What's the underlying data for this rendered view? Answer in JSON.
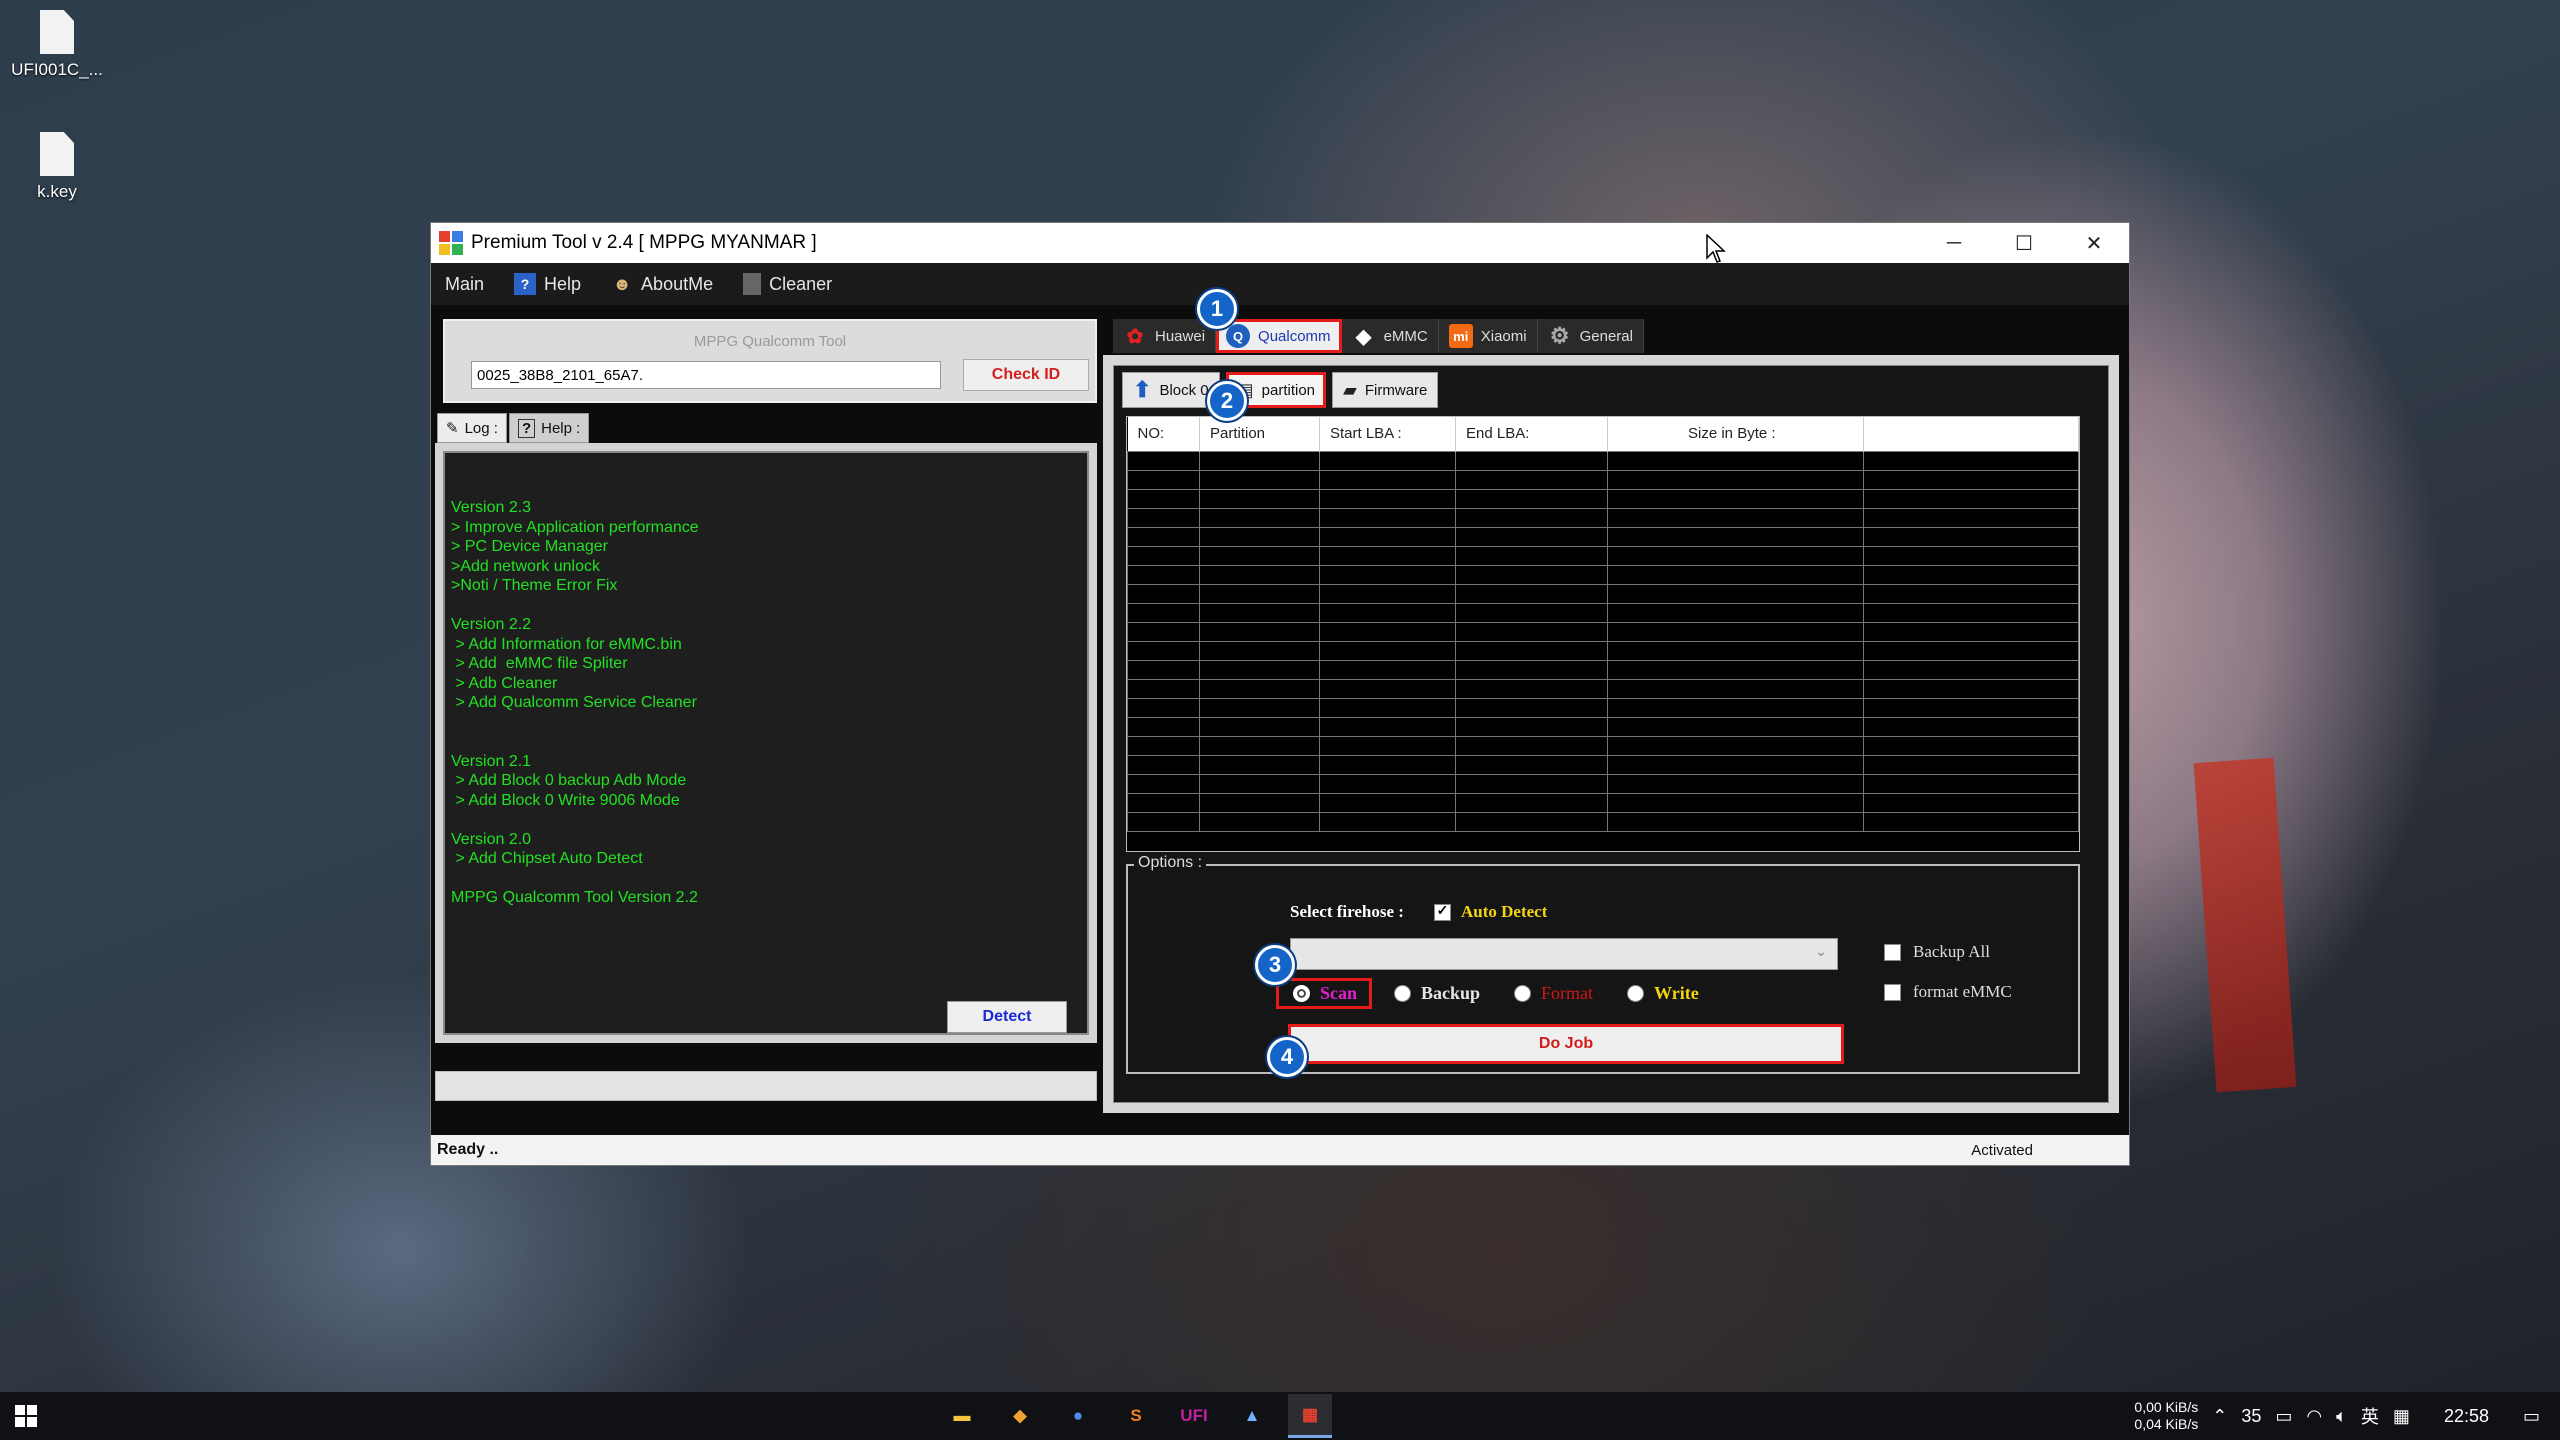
{
  "desktop": {
    "icons": [
      {
        "label": "UFI001C_...",
        "icon": "file-icon"
      },
      {
        "label": "k.key",
        "icon": "file-icon"
      }
    ]
  },
  "window": {
    "title": "Premium Tool v 2.4  [ MPPG MYANMAR ]",
    "controls": {
      "minimize": "─",
      "maximize": "☐",
      "close": "✕"
    }
  },
  "menu": [
    {
      "label": "Main",
      "icon": ""
    },
    {
      "label": "Help",
      "icon": "help-icon"
    },
    {
      "label": "AboutMe",
      "icon": "user-icon"
    },
    {
      "label": "Cleaner",
      "icon": "trash-icon"
    }
  ],
  "left": {
    "tool_label": "MPPG Qualcomm Tool",
    "device_id": "0025_38B8_2101_65A7.",
    "check_id_label": "Check ID",
    "tabs": [
      {
        "label": "Log :"
      },
      {
        "label": "Help :"
      }
    ],
    "log_lines": [
      "Version 2.3",
      "> Improve Application performance",
      "> PC Device Manager",
      ">Add network unlock",
      ">Noti / Theme Error Fix",
      "",
      "Version 2.2",
      " > Add Information for eMMC.bin",
      " > Add  eMMC file Spliter",
      " > Adb Cleaner",
      " > Add Qualcomm Service Cleaner",
      "",
      "",
      "Version 2.1",
      " > Add Block 0 backup Adb Mode",
      " > Add Block 0 Write 9006 Mode",
      "",
      "Version 2.0",
      " > Add Chipset Auto Detect",
      "",
      "MPPG Qualcomm Tool Version 2.2"
    ],
    "detect_label": "Detect"
  },
  "right": {
    "main_tabs": [
      {
        "label": "Huawei",
        "icon": "huawei-icon",
        "active": false
      },
      {
        "label": "Qualcomm",
        "icon": "qualcomm-icon",
        "active": true
      },
      {
        "label": "eMMC",
        "icon": "chip-icon",
        "active": false
      },
      {
        "label": "Xiaomi",
        "icon": "xiaomi-icon",
        "active": false
      },
      {
        "label": "General",
        "icon": "gear-icon",
        "active": false
      }
    ],
    "sub_tabs": [
      {
        "label": "Block 0",
        "icon": "upload-icon",
        "active": false
      },
      {
        "label": "partition",
        "icon": "partition-icon",
        "active": true
      },
      {
        "label": "Firmware",
        "icon": "firmware-icon",
        "active": false
      }
    ],
    "table_headers": [
      "NO:",
      "Partition",
      "Start LBA :",
      "End LBA:",
      "Size in Byte :",
      ""
    ],
    "options": {
      "legend": "Options :",
      "select_firehose_label": "Select firehose :",
      "auto_detect_label": "Auto Detect",
      "auto_detect_checked": true,
      "firehose_value": "",
      "radios": [
        {
          "label": "Scan",
          "color": "#e01fd0",
          "selected": true
        },
        {
          "label": "Backup",
          "color": "#e6e6e6",
          "selected": false
        },
        {
          "label": "Format",
          "color": "#d01818",
          "selected": false
        },
        {
          "label": "Write",
          "color": "#f2d414",
          "selected": false
        }
      ],
      "backup_all_label": "Backup All",
      "format_emmc_label": "format eMMC",
      "do_job_label": "Do Job"
    },
    "markers": [
      "1",
      "2",
      "3",
      "4"
    ]
  },
  "status": {
    "left": "Ready ..",
    "right": "Activated"
  },
  "taskbar": {
    "apps": [
      {
        "name": "file-explorer-icon",
        "glyph": "▬",
        "color": "#f5c542"
      },
      {
        "name": "git-app-icon",
        "glyph": "◆",
        "color": "#f0a030"
      },
      {
        "name": "chrome-icon",
        "glyph": "●",
        "color": "#4a8cf0"
      },
      {
        "name": "sublime-icon",
        "glyph": "S",
        "color": "#f08020"
      },
      {
        "name": "ufi-icon",
        "glyph": "UFI",
        "color": "#c020a0"
      },
      {
        "name": "photos-icon",
        "glyph": "▲",
        "color": "#6fb0ff"
      },
      {
        "name": "premium-tool-icon",
        "glyph": "▦",
        "color": "#e84030"
      }
    ],
    "net_up": "0,00 KiB/s",
    "net_down": "0,04 KiB/s",
    "temp": "35",
    "ime": "英",
    "time": "22:58"
  }
}
